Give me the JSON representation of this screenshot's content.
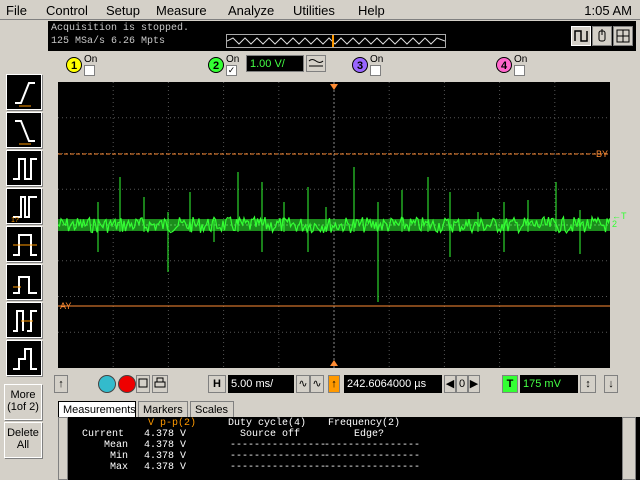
{
  "menu": {
    "items": [
      "File",
      "Control",
      "Setup",
      "Measure",
      "Analyze",
      "Utilities",
      "Help"
    ],
    "clock": "1:05 AM"
  },
  "status": {
    "line1": "Acquisition is stopped.",
    "line2": "125 MSa/s    6.26 Mpts"
  },
  "channels": [
    {
      "num": "1",
      "label": "On",
      "checked": false,
      "color": "#ffff00"
    },
    {
      "num": "2",
      "label": "On",
      "checked": true,
      "color": "#33ff33"
    },
    {
      "num": "3",
      "label": "On",
      "checked": false,
      "color": "#9966ff"
    },
    {
      "num": "4",
      "label": "On",
      "checked": false,
      "color": "#ff66cc"
    }
  ],
  "channel2_scale": "1.00 V/",
  "left_tools": [
    "rising-edge-trigger",
    "falling-edge-trigger",
    "pulse-width-trigger",
    "glitch-trigger",
    "timeout-trigger",
    "runt-trigger",
    "setup-hold-trigger",
    "transition-trigger"
  ],
  "more_button": "More\n(1of 2)",
  "delete_button": "Delete\nAll",
  "markers": {
    "a": "AY",
    "b": "BY"
  },
  "hbar": {
    "h_label": "H",
    "timebase": "5.00 ms/",
    "delay": "242.6064000 µs",
    "t_label": "T",
    "trigger_level": "175 mV"
  },
  "tabs": [
    "Measurements",
    "Markers",
    "Scales"
  ],
  "measurements": {
    "headers": [
      "V p-p(2)",
      "Duty cycle(4)",
      "Frequency(2)"
    ],
    "sub_headers": [
      "",
      "Source off",
      "Edge?"
    ],
    "rows": [
      {
        "label": "Current",
        "vpp": "4.378 V",
        "duty": "",
        "freq": ""
      },
      {
        "label": "Mean",
        "vpp": "4.378 V",
        "duty": "----------------",
        "freq": "----------------"
      },
      {
        "label": "Min",
        "vpp": "4.378 V",
        "duty": "----------------",
        "freq": "----------------"
      },
      {
        "label": "Max",
        "vpp": "4.378 V",
        "duty": "----------------",
        "freq": "----------------"
      }
    ]
  },
  "colors": {
    "trace": "#33ff33",
    "marker": "#ff8c33",
    "grid": "#555555"
  }
}
